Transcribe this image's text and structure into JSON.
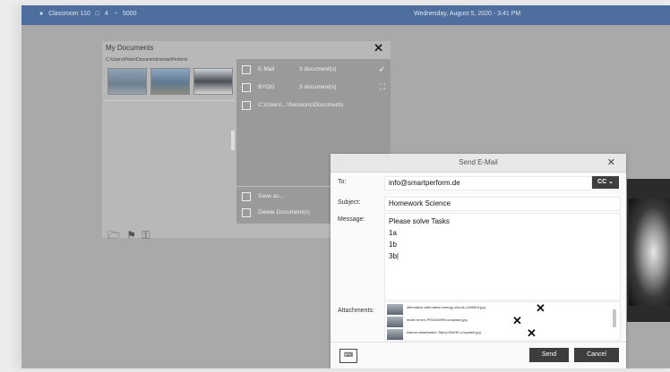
{
  "topbar": {
    "classroom": "Classroom 110",
    "screens": "4",
    "wifi": "5000",
    "datetime": "Wednesday, August 5, 2020 - 3:41 PM"
  },
  "docwin": {
    "title": "My Documents",
    "path": "C:\\Users\\Peter\\Documents\\smartPerform",
    "menu": [
      {
        "label": "E-Mail",
        "count": "3 document(s)",
        "icon": "send-icon"
      },
      {
        "label": "BYOD",
        "count": "3 document(s)",
        "icon": "devices-icon"
      },
      {
        "label": "C:\\Users\\...\\Sessions\\Documents",
        "count": "",
        "icon": "folder-icon"
      }
    ],
    "bottom_menu": [
      {
        "label": "Save as...",
        "icon": "save-icon"
      },
      {
        "label": "Delete Document(s)",
        "icon": "trash-icon"
      }
    ]
  },
  "mail": {
    "title": "Send E-Mail",
    "to_label": "To:",
    "to_value": "info@smartperform.de",
    "cc_label": "CC",
    "subject_label": "Subject:",
    "subject_value": "Homework Science",
    "message_label": "Message:",
    "message_lines": [
      "Please solve Tasks",
      "1a",
      "1b",
      "3b|"
    ],
    "attachments_label": "Attachments:",
    "attachments": [
      {
        "name": "alternative-alternative-energy-clouds-1108814.jpg"
      },
      {
        "name": "mulle-renen-PfS3zM4Rb-unsplash.jpg"
      },
      {
        "name": "dalene-wasehaster-TakeyY8UHE-unsplash.jpg"
      }
    ],
    "keyboard_label": "⌨",
    "send_label": "Send",
    "cancel_label": "Cancel"
  }
}
